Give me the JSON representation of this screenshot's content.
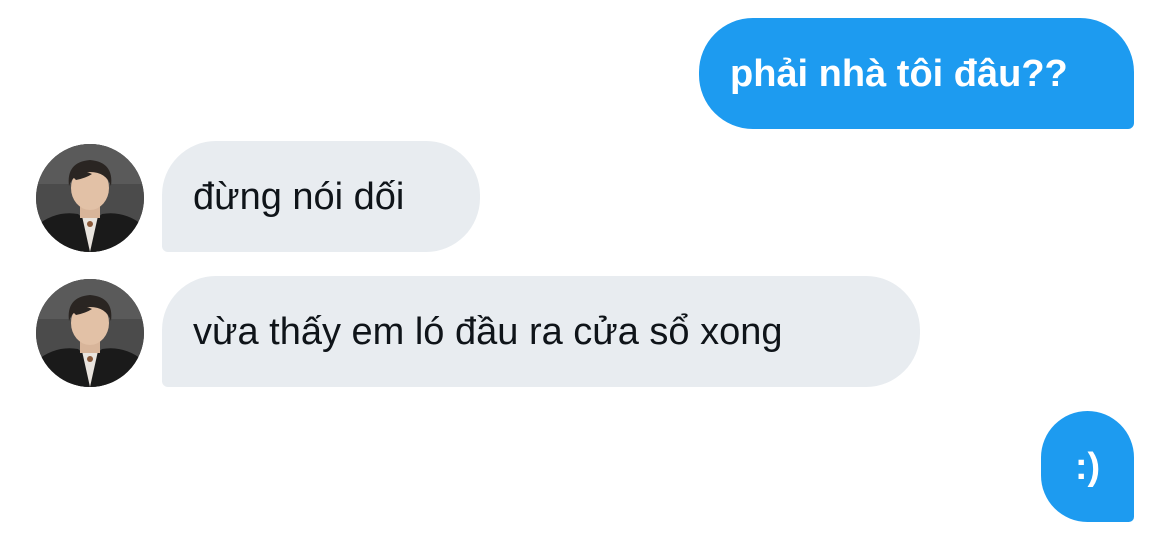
{
  "conversation": {
    "messages": [
      {
        "direction": "sent",
        "text": "phải nhà tôi đâu??"
      },
      {
        "direction": "received",
        "text": "đừng nói dối"
      },
      {
        "direction": "received",
        "text": "vừa thấy em ló đầu ra cửa sổ xong"
      },
      {
        "direction": "sent",
        "text": ":)"
      }
    ]
  },
  "colors": {
    "sent_bubble": "#1D9BF0",
    "received_bubble": "#E8ECF0",
    "sent_text": "#FFFFFF",
    "received_text": "#0F1419"
  },
  "icons": {
    "avatar": "user-photo-avatar"
  }
}
